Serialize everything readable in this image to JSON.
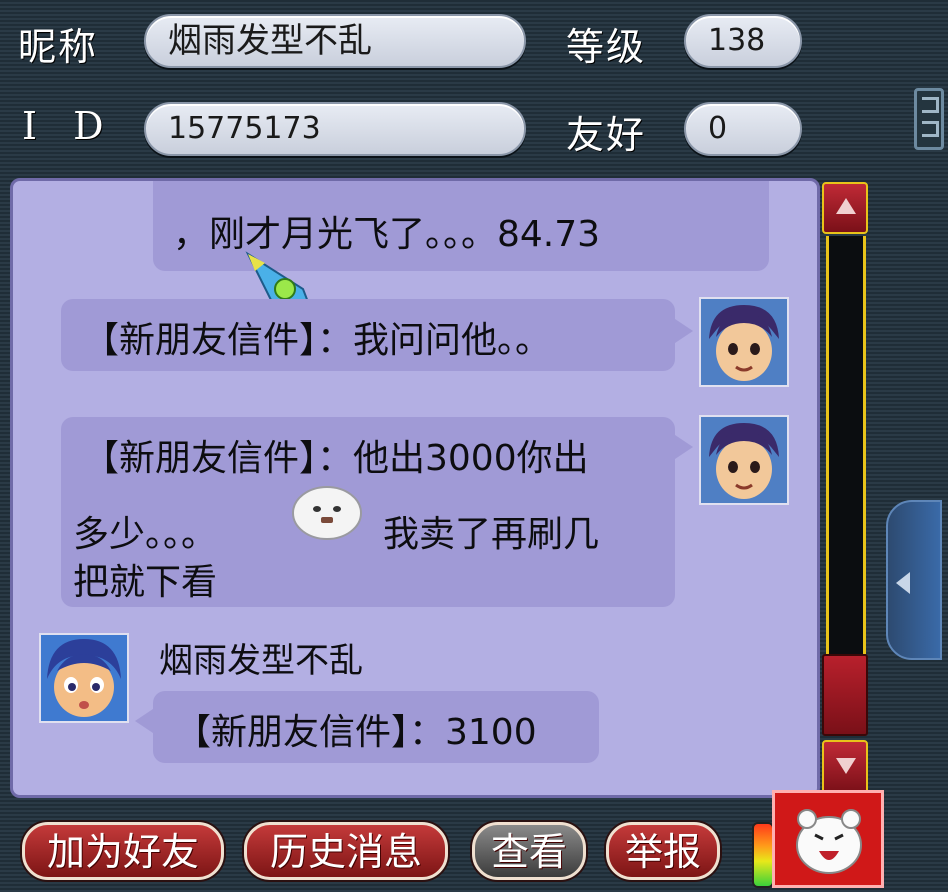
{
  "header": {
    "nickname_label": "昵称",
    "nickname_value": "烟雨发型不乱",
    "level_label": "等级",
    "level_value": "138",
    "id_label": "I D",
    "id_value": "15775173",
    "friendship_label": "友好",
    "friendship_value": "0"
  },
  "messages": [
    {
      "text": "，刚才月光飞了。。。84.73"
    },
    {
      "text": "【新朋友信件】：我问问他。。"
    },
    {
      "text_line1": "【新朋友信件】：他出3000你出",
      "text_line2_a": "多少。。。",
      "text_line2_b": "我卖了再刷几",
      "text_line3": "把就下看"
    },
    {
      "sender": "烟雨发型不乱",
      "text": "【新朋友信件】：3100"
    }
  ],
  "buttons": {
    "add_friend": "加为好友",
    "history": "历史消息",
    "view": "查看",
    "report": "举报"
  },
  "colors": {
    "panel": "#b3afe3",
    "bubble": "#a09ad6",
    "scroll_track": "#e8c31a",
    "scroll_button": "#a01d2a"
  }
}
